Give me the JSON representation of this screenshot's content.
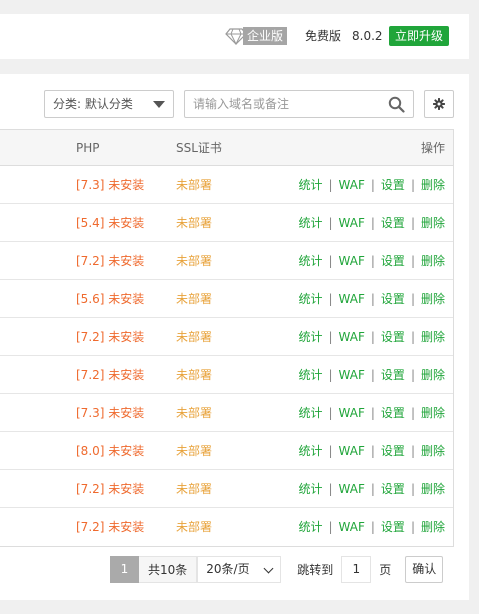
{
  "header": {
    "enterprise_label": "企业版",
    "edition": "免费版",
    "version": "8.0.2",
    "upgrade_label": "立即升级"
  },
  "toolbar": {
    "category_select": "分类: 默认分类",
    "search_placeholder": "请输入域名或备注"
  },
  "table": {
    "columns": {
      "php": "PHP",
      "ssl": "SSL证书",
      "ops": "操作"
    },
    "op_labels": {
      "stats": "统计",
      "waf": "WAF",
      "settings": "设置",
      "delete": "删除",
      "sep": "|"
    },
    "rows": [
      {
        "php": "[7.3] 未安装",
        "ssl": "未部署"
      },
      {
        "php": "[5.4] 未安装",
        "ssl": "未部署"
      },
      {
        "php": "[7.2] 未安装",
        "ssl": "未部署"
      },
      {
        "php": "[5.6] 未安装",
        "ssl": "未部署"
      },
      {
        "php": "[7.2] 未安装",
        "ssl": "未部署"
      },
      {
        "php": "[7.2] 未安装",
        "ssl": "未部署"
      },
      {
        "php": "[7.3] 未安装",
        "ssl": "未部署"
      },
      {
        "php": "[8.0] 未安装",
        "ssl": "未部署"
      },
      {
        "php": "[7.2] 未安装",
        "ssl": "未部署"
      },
      {
        "php": "[7.2] 未安装",
        "ssl": "未部署"
      }
    ]
  },
  "pagination": {
    "current_page": "1",
    "total": "共10条",
    "page_size": "20条/页",
    "jump_label": "跳转到",
    "jump_value": "1",
    "page_suffix": "页",
    "confirm_label": "确认"
  },
  "colors": {
    "brand_green": "#20a53a",
    "php_orange": "#ef6a2e",
    "ssl_orange": "#e8a23a"
  }
}
